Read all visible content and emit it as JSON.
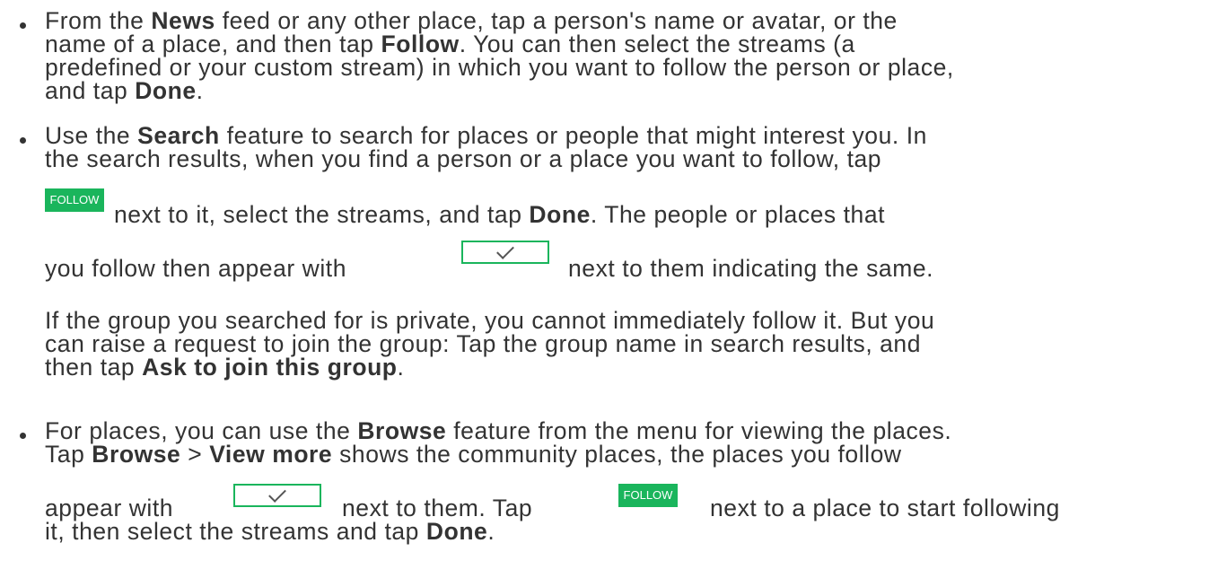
{
  "items": [
    {
      "lines": [
        [
          "From the ",
          {
            "b": "News"
          },
          " feed or any other place, tap a person's name or avatar, or the"
        ],
        [
          "name of a place, and then tap ",
          {
            "b": "Follow"
          },
          ". You can then select the streams (a"
        ],
        [
          "predefined or your custom stream) in which you want to follow the person or place,"
        ],
        [
          "and tap ",
          {
            "b": "Done"
          },
          "."
        ]
      ]
    },
    {
      "lines": [
        [
          "Use the ",
          {
            "b": "Search"
          },
          " feature to search for places or people that might interest you. In"
        ],
        [
          "the search results, when you find a person or a place you want to follow, tap"
        ]
      ]
    }
  ],
  "follow_label": "FOLLOW",
  "item2": {
    "line3": [
      "next to it, select the streams, and tap ",
      {
        "b": "Done"
      },
      ". The people or places that"
    ],
    "line4_pre": "you follow then appear with",
    "line4_post": "next to them indicating the same.",
    "para": [
      [
        "If the group you searched for is private, you cannot immediately follow it. But you"
      ],
      [
        "can raise a request to join the group: Tap the group name in search results, and"
      ],
      [
        "then tap ",
        {
          "b": "Ask to join this group"
        },
        "."
      ]
    ]
  },
  "item3": {
    "lines": [
      [
        "For places, you can use the ",
        {
          "b": "Browse"
        },
        " feature from the menu for viewing the places."
      ],
      [
        "Tap  ",
        {
          "b": "Browse"
        },
        " > ",
        {
          "b": "View more"
        },
        "  shows the community places, the places you follow"
      ]
    ],
    "line3_a": "appear with",
    "line3_b": "next to them. Tap",
    "line3_c": "next to a place to start following",
    "line4": [
      "it, then select the streams and tap ",
      {
        "b": "Done"
      },
      "."
    ]
  }
}
